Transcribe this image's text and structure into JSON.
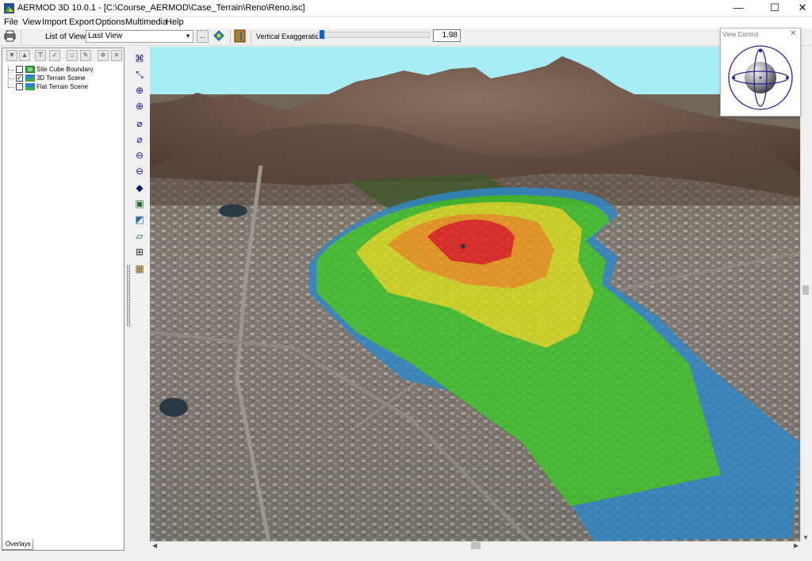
{
  "window": {
    "title": "AERMOD 3D 10.0.1 - [C:\\Course_AERMOD\\Case_Terrain\\Reno\\Reno.isc]",
    "minimize_glyph": "—",
    "maximize_glyph": "☐",
    "close_glyph": "✕"
  },
  "menu": [
    "File",
    "View",
    "Import",
    "Export",
    "Options",
    "Multimedia",
    "Help"
  ],
  "toolbar": {
    "list_of_views_label": "List of Views:",
    "list_of_views_value": "Last View",
    "browse_label": "...",
    "vertical_exaggeration_label": "Vertical Exaggeration:",
    "vertical_exaggeration_value": "1.98",
    "vertical_exaggeration_fraction": 0.02
  },
  "layers": [
    {
      "label": "Site Cube Boundary",
      "checked": false,
      "check_glyph": ""
    },
    {
      "label": "3D Terrain Scene",
      "checked": true,
      "check_glyph": "✓"
    },
    {
      "label": "Flat Terrain Scene",
      "checked": false,
      "check_glyph": ""
    }
  ],
  "panel_tab": "Overlays",
  "view_control": {
    "title": "View Control",
    "close_glyph": "✕"
  },
  "colors": {
    "sky": "#a8ecf5",
    "contour_red": "#e8201c",
    "contour_orange": "#f29a1a",
    "contour_yellow": "#d8e01e",
    "contour_green": "#3fc52a",
    "contour_blue": "#2f88c8"
  },
  "icons": {
    "app": "aermod-app-icon",
    "print": "printer-icon",
    "globe_view": "globe-view-icon",
    "book": "book-icon"
  }
}
